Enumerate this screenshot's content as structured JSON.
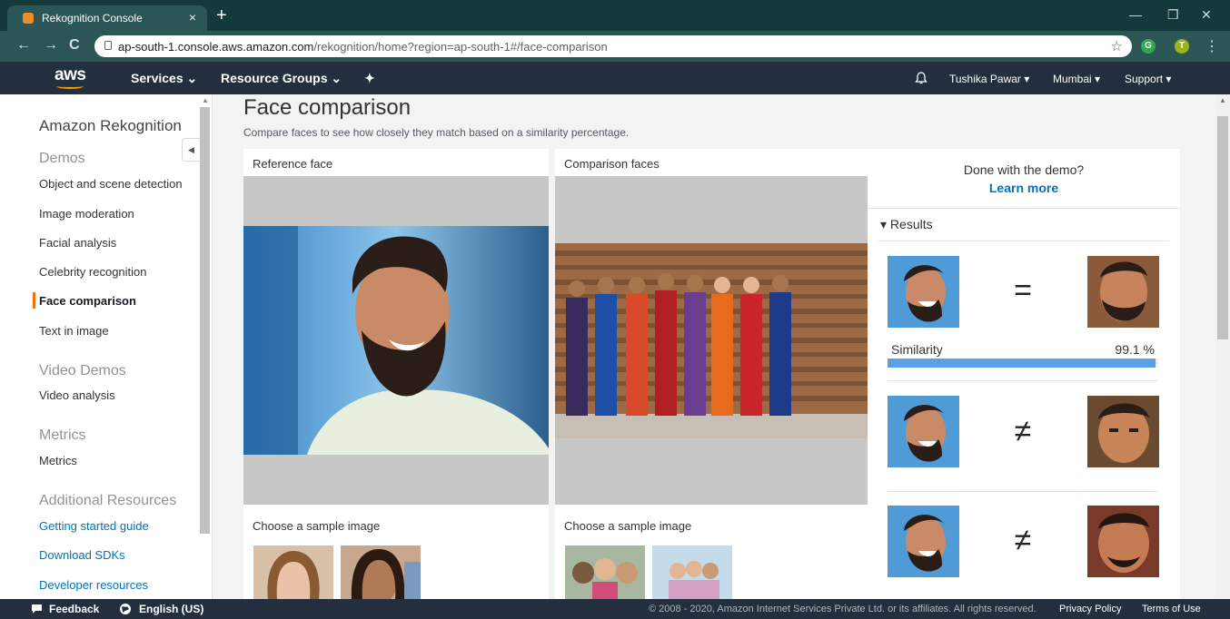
{
  "browser": {
    "tab_title": "Rekognition Console",
    "tab_close": "×",
    "new_tab": "+",
    "url_host": "ap-south-1.console.aws.amazon.com",
    "url_path": "/rekognition/home?region=ap-south-1#/face-comparison",
    "nav_back": "←",
    "nav_forward": "→",
    "nav_reload": "C",
    "star": "☆",
    "ext_g": "G",
    "ext_t": "T",
    "menu": "⋮",
    "win_min": "—",
    "win_max": "❐",
    "win_close": "✕"
  },
  "aws_nav": {
    "logo": "aws",
    "services": "Services ⌄",
    "resource_groups": "Resource Groups ⌄",
    "pin": "✦",
    "user": "Tushika Pawar ▾",
    "region": "Mumbai ▾",
    "support": "Support ▾"
  },
  "sidebar": {
    "title": "Amazon Rekognition",
    "sections": [
      {
        "heading": "Demos",
        "items": [
          "Object and scene detection",
          "Image moderation",
          "Facial analysis",
          "Celebrity recognition",
          "Face comparison",
          "Text in image"
        ]
      },
      {
        "heading": "Video Demos",
        "items": [
          "Video analysis"
        ]
      },
      {
        "heading": "Metrics",
        "items": [
          "Metrics"
        ]
      },
      {
        "heading": "Additional Resources",
        "links": [
          "Getting started guide",
          "Download SDKs",
          "Developer resources"
        ]
      }
    ],
    "active_item": "Face comparison"
  },
  "main": {
    "title": "Face comparison",
    "subtitle": "Compare faces to see how closely they match based on a similarity percentage.",
    "reference_label": "Reference face",
    "comparison_label": "Comparison faces",
    "sample_label": "Choose a sample image"
  },
  "results": {
    "done_text": "Done with the demo?",
    "learn_more": "Learn more",
    "heading": "▾  Results",
    "matches": [
      {
        "symbol": "=",
        "similarity_label": "Similarity",
        "similarity_value": "99.1 %",
        "similarity": 0.991
      },
      {
        "symbol": "≠"
      },
      {
        "symbol": "≠"
      }
    ]
  },
  "footer": {
    "feedback": "Feedback",
    "language": "English (US)",
    "copyright": "© 2008 - 2020, Amazon Internet Services Private Ltd. or its affiliates. All rights reserved.",
    "privacy": "Privacy Policy",
    "terms": "Terms of Use"
  },
  "colors": {
    "aws_nav": "#232f3e",
    "accent_orange": "#ec7211",
    "link_blue": "#0073bb",
    "similarity_bar": "#5aa0e8"
  }
}
